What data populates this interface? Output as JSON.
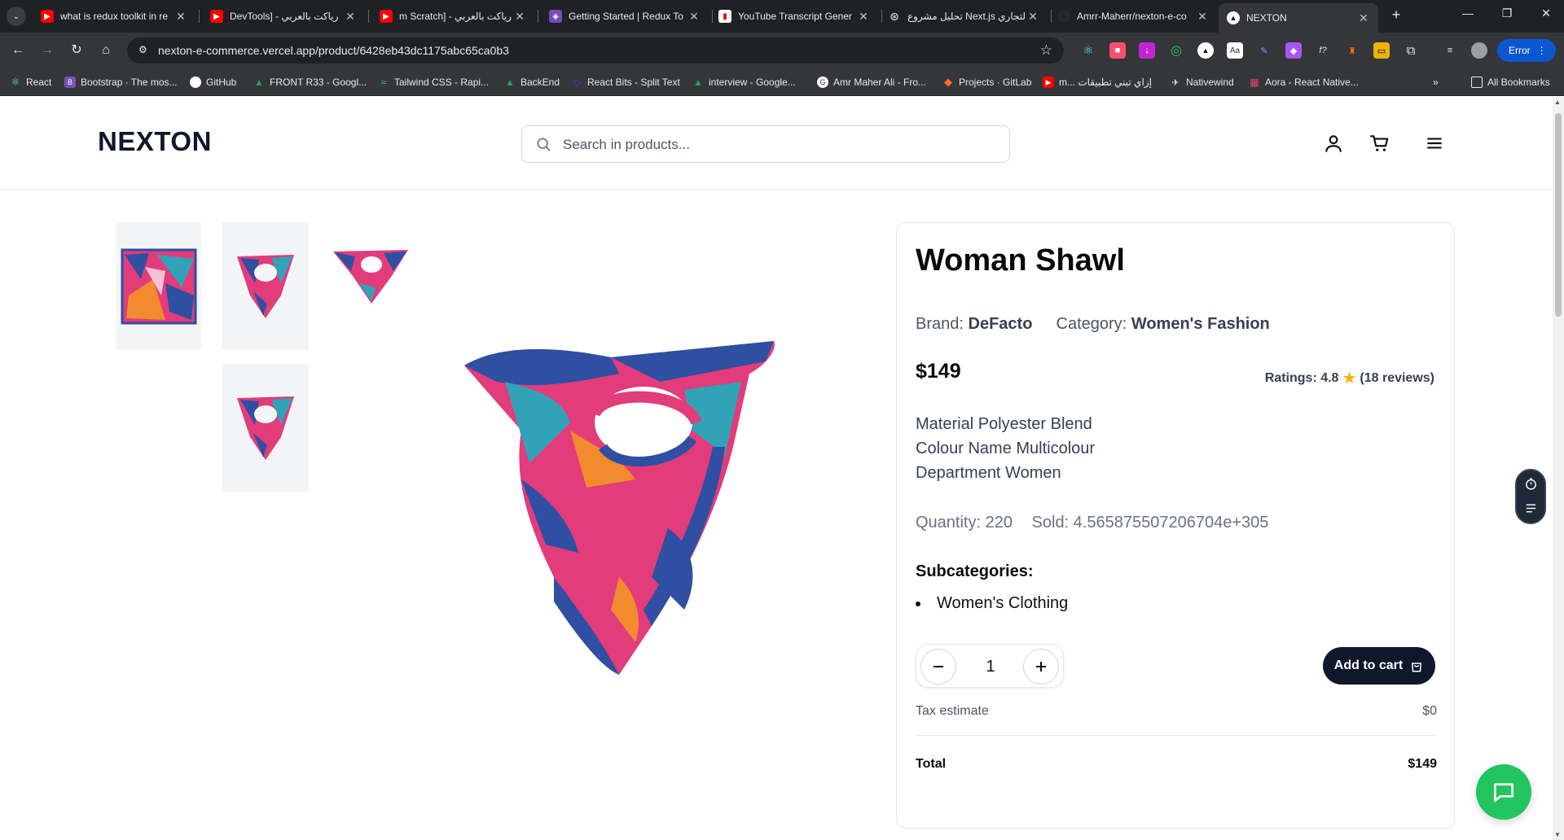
{
  "browser": {
    "tabs": [
      {
        "title": "what is redux toolkit in re",
        "fav_color": "#ff0000"
      },
      {
        "title": "DevTools] - رياكت بالعربي",
        "fav_color": "#ff0000"
      },
      {
        "title": "m Scratch] - رياكت بالعربي",
        "fav_color": "#ff0000"
      },
      {
        "title": "Getting Started | Redux To",
        "fav_color": "#764abc"
      },
      {
        "title": "YouTube Transcript Gener",
        "fav_color": "#ffffff"
      },
      {
        "title": "تحليل مشروع Next.js التجاري",
        "fav_color": "#9aa0a6"
      },
      {
        "title": "Amrr-Maherr/nexton-e-co",
        "fav_color": "#24292f"
      },
      {
        "title": "NEXTON",
        "fav_color": "#ffffff"
      }
    ],
    "url": "nexton-e-commerce.vercel.app/product/6428eb43dc1175abc65ca0b3",
    "error_label": "Error",
    "bookmarks": [
      {
        "label": "React",
        "fav_color": "#61dafb"
      },
      {
        "label": "Bootstrap · The mos...",
        "fav_color": "#7952b3"
      },
      {
        "label": "GitHub",
        "fav_color": "#ffffff"
      },
      {
        "label": "FRONT R33 - Googl...",
        "fav_color": "#1fa463"
      },
      {
        "label": "Tailwind CSS - Rapi...",
        "fav_color": "#38bdf8"
      },
      {
        "label": "BackEnd",
        "fav_color": "#1fa463"
      },
      {
        "label": "React Bits - Split Text",
        "fav_color": "#5227ff"
      },
      {
        "label": "interview - Google...",
        "fav_color": "#1fa463"
      },
      {
        "label": "Amr Maher Ali - Fro...",
        "fav_color": "#ffffff"
      },
      {
        "label": "Projects · GitLab",
        "fav_color": "#fc6d26"
      },
      {
        "label": "m... إزاي تبني تطبيقات",
        "fav_color": "#ff0000"
      },
      {
        "label": "Nativewind",
        "fav_color": "#9aa0a6"
      },
      {
        "label": "Aora - React Native...",
        "fav_color": "#e8456b"
      }
    ],
    "all_bookmarks_label": "All Bookmarks"
  },
  "site": {
    "logo": "NEXTON",
    "search_placeholder": "Search in products..."
  },
  "product": {
    "title": "Woman Shawl",
    "brand_label": "Brand:",
    "brand": "DeFacto",
    "category_label": "Category:",
    "category": "Women's Fashion",
    "price": "$149",
    "ratings_label": "Ratings: 4.8",
    "reviews": "(18 reviews)",
    "description": [
      "Material Polyester Blend",
      "Colour Name Multicolour",
      "Department Women"
    ],
    "quantity_label": "Quantity: 220",
    "sold_label": "Sold: 4.565875507206704e+305",
    "subcategories_heading": "Subcategories:",
    "subcategories": [
      "Women's Clothing"
    ],
    "qty_value": "1",
    "add_to_cart_label": "Add to cart",
    "tax_label": "Tax estimate",
    "tax_value": "$0",
    "total_label": "Total",
    "total_value": "$149"
  },
  "colors": {
    "accent_dark": "#0f172a",
    "chat_green": "#22c55e",
    "star": "#f5b301"
  }
}
